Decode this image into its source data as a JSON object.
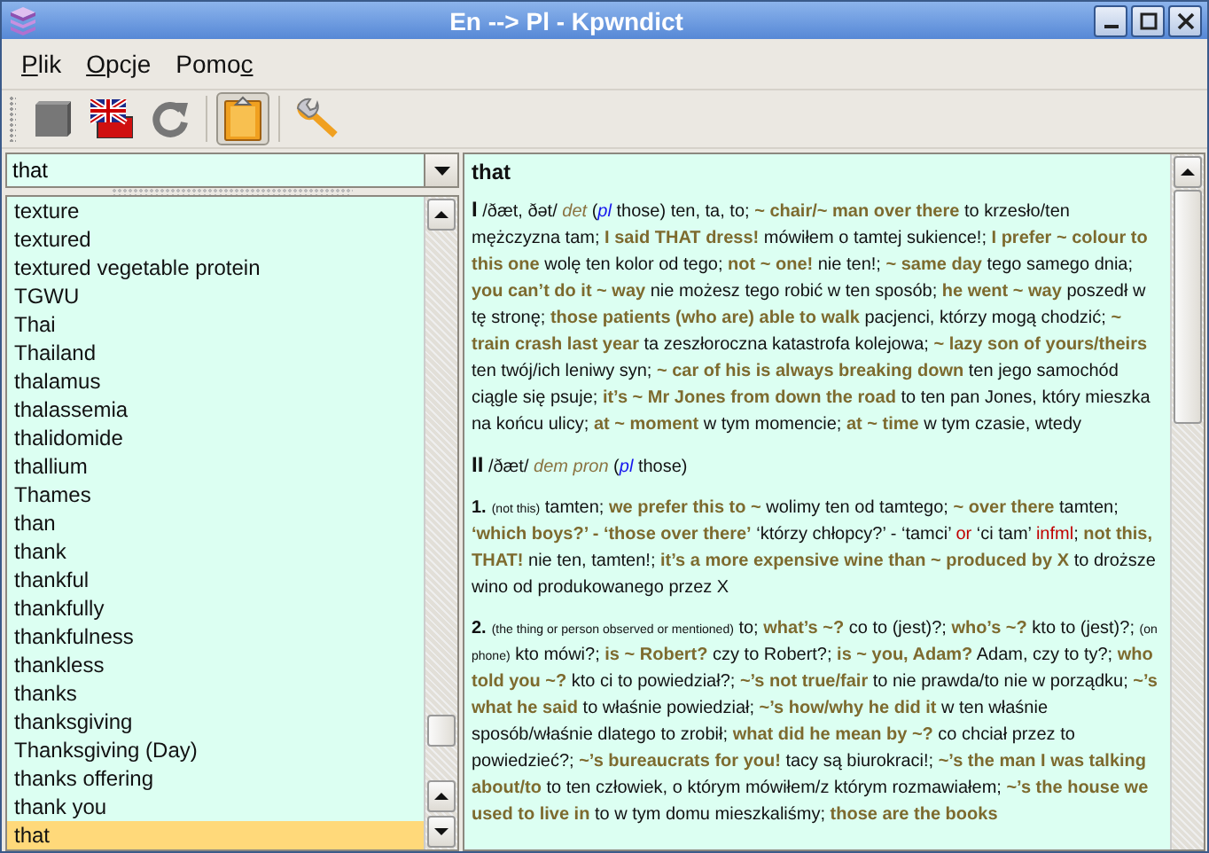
{
  "window": {
    "title": "En --> Pl - Kpwndict"
  },
  "menu": [
    {
      "key": "P",
      "post": "lik"
    },
    {
      "key": "O",
      "post": "pcje"
    },
    {
      "pre": "Pomo",
      "key": "c"
    }
  ],
  "toolbar": [
    {
      "kind": "stop",
      "pressed": false
    },
    {
      "kind": "flag",
      "pressed": false
    },
    {
      "kind": "refresh",
      "pressed": false
    },
    {
      "kind": "separator"
    },
    {
      "kind": "clipboard",
      "pressed": true
    },
    {
      "kind": "separator"
    },
    {
      "kind": "tools",
      "pressed": false
    }
  ],
  "search": {
    "value": "that"
  },
  "word_list": [
    {
      "label": "texture",
      "selected": false
    },
    {
      "label": "textured",
      "selected": false
    },
    {
      "label": "textured vegetable protein",
      "selected": false
    },
    {
      "label": "TGWU",
      "selected": false
    },
    {
      "label": "Thai",
      "selected": false
    },
    {
      "label": "Thailand",
      "selected": false
    },
    {
      "label": "thalamus",
      "selected": false
    },
    {
      "label": "thalassemia",
      "selected": false
    },
    {
      "label": "thalidomide",
      "selected": false
    },
    {
      "label": "thallium",
      "selected": false
    },
    {
      "label": "Thames",
      "selected": false
    },
    {
      "label": "than",
      "selected": false
    },
    {
      "label": "thank",
      "selected": false
    },
    {
      "label": "thankful",
      "selected": false
    },
    {
      "label": "thankfully",
      "selected": false
    },
    {
      "label": "thankfulness",
      "selected": false
    },
    {
      "label": "thankless",
      "selected": false
    },
    {
      "label": "thanks",
      "selected": false
    },
    {
      "label": "thanksgiving",
      "selected": false
    },
    {
      "label": "Thanksgiving (Day)",
      "selected": false
    },
    {
      "label": "thanks offering",
      "selected": false
    },
    {
      "label": "thank you",
      "selected": false
    },
    {
      "label": "that",
      "selected": true
    }
  ],
  "entry": {
    "headword": "that",
    "paragraphs": [
      {
        "segments": [
          {
            "kind": "num",
            "text": "I"
          },
          {
            "kind": "text",
            "text": " /ðæt, ðət/ "
          },
          {
            "kind": "pos",
            "text": "det"
          },
          {
            "kind": "text",
            "text": " ("
          },
          {
            "kind": "abbr",
            "text": "pl"
          },
          {
            "kind": "text",
            "text": " those) ten, ta, to; "
          },
          {
            "kind": "phrase",
            "text": "~ chair/~ man over there"
          },
          {
            "kind": "text",
            "text": " to krzesło/ten mężczyzna tam; "
          },
          {
            "kind": "phrase",
            "text": "I said THAT dress!"
          },
          {
            "kind": "text",
            "text": " mówiłem o tamtej sukience!; "
          },
          {
            "kind": "phrase",
            "text": "I prefer ~ colour to this one"
          },
          {
            "kind": "text",
            "text": " wolę ten kolor od tego; "
          },
          {
            "kind": "phrase",
            "text": "not ~ one!"
          },
          {
            "kind": "text",
            "text": " nie ten!; "
          },
          {
            "kind": "phrase",
            "text": "~ same day"
          },
          {
            "kind": "text",
            "text": " tego samego dnia; "
          },
          {
            "kind": "phrase",
            "text": "you can’t do it ~ way"
          },
          {
            "kind": "text",
            "text": " nie możesz tego robić w ten sposób; "
          },
          {
            "kind": "phrase",
            "text": "he went ~ way"
          },
          {
            "kind": "text",
            "text": " poszedł w tę stronę; "
          },
          {
            "kind": "phrase",
            "text": "those patients (who are) able to walk"
          },
          {
            "kind": "text",
            "text": " pacjenci, którzy mogą chodzić; "
          },
          {
            "kind": "phrase",
            "text": "~ train crash last year"
          },
          {
            "kind": "text",
            "text": " ta zeszłoroczna katastrofa kolejowa; "
          },
          {
            "kind": "phrase",
            "text": "~ lazy son of yours/theirs"
          },
          {
            "kind": "text",
            "text": " ten twój/ich leniwy syn; "
          },
          {
            "kind": "phrase",
            "text": "~ car of his is always breaking down"
          },
          {
            "kind": "text",
            "text": " ten jego samochód ciągle się psuje; "
          },
          {
            "kind": "phrase",
            "text": "it’s ~ Mr Jones from down the road"
          },
          {
            "kind": "text",
            "text": " to ten pan Jones, który mieszka na końcu ulicy; "
          },
          {
            "kind": "phrase",
            "text": "at ~ moment"
          },
          {
            "kind": "text",
            "text": " w tym momencie; "
          },
          {
            "kind": "phrase",
            "text": "at ~ time"
          },
          {
            "kind": "text",
            "text": " w tym czasie, wtedy"
          }
        ]
      },
      {
        "segments": [
          {
            "kind": "num",
            "text": "II"
          },
          {
            "kind": "text",
            "text": " /ðæt/ "
          },
          {
            "kind": "pos",
            "text": "dem pron"
          },
          {
            "kind": "text",
            "text": " ("
          },
          {
            "kind": "abbr",
            "text": "pl"
          },
          {
            "kind": "text",
            "text": " those)"
          }
        ]
      },
      {
        "segments": [
          {
            "kind": "sub",
            "text": "1."
          },
          {
            "kind": "note",
            "text": "(not this)"
          },
          {
            "kind": "text",
            "text": " tamten; "
          },
          {
            "kind": "phrase",
            "text": "we prefer this to ~"
          },
          {
            "kind": "text",
            "text": " wolimy ten od tamtego; "
          },
          {
            "kind": "phrase",
            "text": "~ over there"
          },
          {
            "kind": "text",
            "text": " tamten; "
          },
          {
            "kind": "phrase",
            "text": "‘which boys?’ - ‘those over there’"
          },
          {
            "kind": "text",
            "text": " ‘którzy chłopcy?’ - ‘tamci’ "
          },
          {
            "kind": "label",
            "text": "or"
          },
          {
            "kind": "text",
            "text": " ‘ci tam’ "
          },
          {
            "kind": "label",
            "text": "infml"
          },
          {
            "kind": "text",
            "text": "; "
          },
          {
            "kind": "phrase",
            "text": "not this, THAT!"
          },
          {
            "kind": "text",
            "text": " nie ten, tamten!; "
          },
          {
            "kind": "phrase",
            "text": "it’s a more expensive wine than ~ produced by X"
          },
          {
            "kind": "text",
            "text": " to droższe wino od produkowanego przez X"
          }
        ]
      },
      {
        "segments": [
          {
            "kind": "sub",
            "text": "2."
          },
          {
            "kind": "note",
            "text": "(the thing or person observed or mentioned)"
          },
          {
            "kind": "text",
            "text": " to; "
          },
          {
            "kind": "phrase",
            "text": "what’s ~?"
          },
          {
            "kind": "text",
            "text": " co to (jest)?; "
          },
          {
            "kind": "phrase",
            "text": "who’s ~?"
          },
          {
            "kind": "text",
            "text": " kto to (jest)?; "
          },
          {
            "kind": "note",
            "text": "(on phone)"
          },
          {
            "kind": "text",
            "text": " kto mówi?; "
          },
          {
            "kind": "phrase",
            "text": "is ~ Robert?"
          },
          {
            "kind": "text",
            "text": " czy to Robert?; "
          },
          {
            "kind": "phrase",
            "text": "is ~ you, Adam?"
          },
          {
            "kind": "text",
            "text": " Adam, czy to ty?; "
          },
          {
            "kind": "phrase",
            "text": "who told you ~?"
          },
          {
            "kind": "text",
            "text": " kto ci to powiedział?; "
          },
          {
            "kind": "phrase",
            "text": "~’s not true/fair"
          },
          {
            "kind": "text",
            "text": " to nie prawda/to nie w porządku; "
          },
          {
            "kind": "phrase",
            "text": "~’s what he said"
          },
          {
            "kind": "text",
            "text": " to właśnie powiedział; "
          },
          {
            "kind": "phrase",
            "text": "~’s how/why he did it"
          },
          {
            "kind": "text",
            "text": " w ten właśnie sposób/właśnie dlatego to zrobił; "
          },
          {
            "kind": "phrase",
            "text": "what did he mean by ~?"
          },
          {
            "kind": "text",
            "text": " co chciał przez to powiedzieć?; "
          },
          {
            "kind": "phrase",
            "text": "~’s bureaucrats for you!"
          },
          {
            "kind": "text",
            "text": " tacy są biurokraci!; "
          },
          {
            "kind": "phrase",
            "text": "~’s the man I was talking about/to"
          },
          {
            "kind": "text",
            "text": " to ten człowiek, o którym mówiłem/z którym rozmawiałem; "
          },
          {
            "kind": "phrase",
            "text": "~’s the house we used to live in"
          },
          {
            "kind": "text",
            "text": " to w tym domu mieszkaliśmy; "
          },
          {
            "kind": "phrase",
            "text": "those are the books"
          }
        ]
      }
    ]
  }
}
